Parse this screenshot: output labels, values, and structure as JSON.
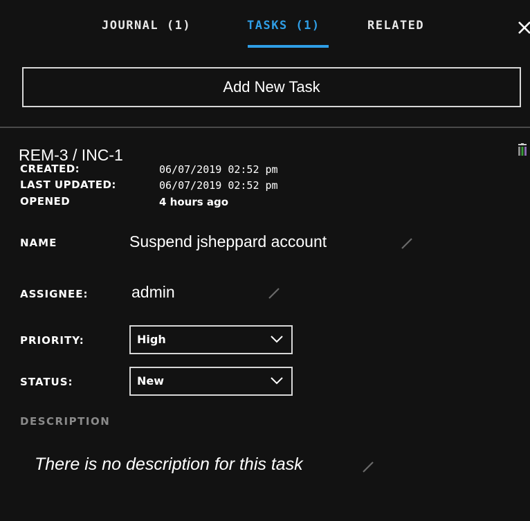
{
  "tabs": [
    {
      "label": "JOURNAL (1)",
      "active": false
    },
    {
      "label": "TASKS (1)",
      "active": true
    },
    {
      "label": "RELATED",
      "active": false
    }
  ],
  "close_icon": "close-icon",
  "add_task_label": "Add New Task",
  "task": {
    "id": "REM-3  /  INC-1",
    "created_label": "CREATED:",
    "created_value": "06/07/2019 02:52 pm",
    "updated_label": "LAST UPDATED:",
    "updated_value": "06/07/2019 02:52 pm",
    "opened_label": "OPENED",
    "opened_value": "4 hours ago",
    "name_label": "NAME",
    "name_value": "Suspend jsheppard account",
    "assignee_label": "ASSIGNEE:",
    "assignee_value": "admin",
    "priority_label": "PRIORITY:",
    "priority_value": "High",
    "status_label": "STATUS:",
    "status_value": "New",
    "description_label": "DESCRIPTION",
    "description_value": "There is no description for this task"
  },
  "colors": {
    "background": "#121212",
    "accent": "#2f9ee6",
    "border": "#d8d8d8",
    "muted": "#8a8a8a"
  },
  "icons": [
    "close-icon",
    "trash-icon",
    "pencil-icon",
    "chevron-down-icon"
  ]
}
